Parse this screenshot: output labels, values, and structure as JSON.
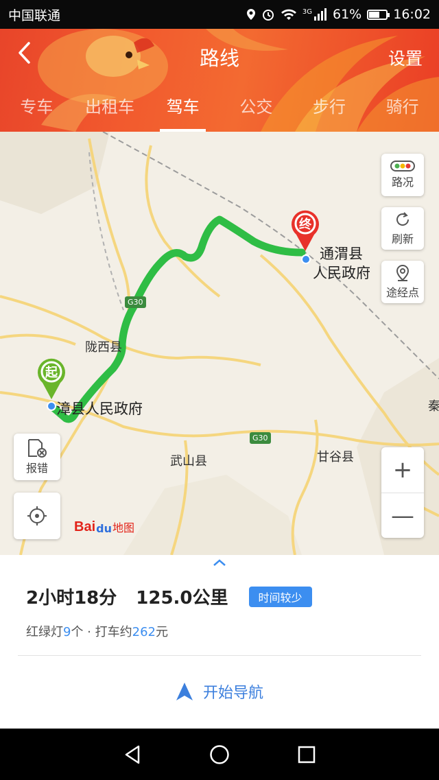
{
  "status_bar": {
    "carrier": "中国联通",
    "network": "3G",
    "battery": "61%",
    "battery_level": 0.61,
    "time": "16:02"
  },
  "header": {
    "back_icon": "back-arrow-icon",
    "title": "路线",
    "settings_label": "设置"
  },
  "tabs": [
    {
      "label": "专车",
      "active": false
    },
    {
      "label": "出租车",
      "active": false
    },
    {
      "label": "驾车",
      "active": true
    },
    {
      "label": "公交",
      "active": false
    },
    {
      "label": "步行",
      "active": false
    },
    {
      "label": "骑行",
      "active": false
    }
  ],
  "map": {
    "start_pin": "起",
    "end_pin": "终",
    "start_label": "漳县人民政府",
    "end_label_line1": "通渭县",
    "end_label_line2": "人民政府",
    "places": {
      "longxi": "陇西县",
      "wushan": "武山县",
      "gangu": "甘谷县",
      "qin": "秦"
    },
    "highway_shield": "G30",
    "route_color": "#2fbd45",
    "controls": {
      "traffic": "路况",
      "refresh": "刷新",
      "waypoint": "途经点",
      "report": "报错"
    },
    "zoom_in": "+",
    "zoom_out": "—",
    "logo": {
      "bai": "Bai",
      "du": "du",
      "ditu": "地图"
    }
  },
  "route": {
    "duration": "2小时18分",
    "distance": "125.0公里",
    "tag": "时间较少",
    "lights_prefix": "红绿灯",
    "lights_count": "9",
    "lights_suffix": "个 · 打车约",
    "taxi_fare": "262",
    "fare_unit": "元",
    "accent_color": "#3c8ef0"
  },
  "navigate_label": "开始导航"
}
